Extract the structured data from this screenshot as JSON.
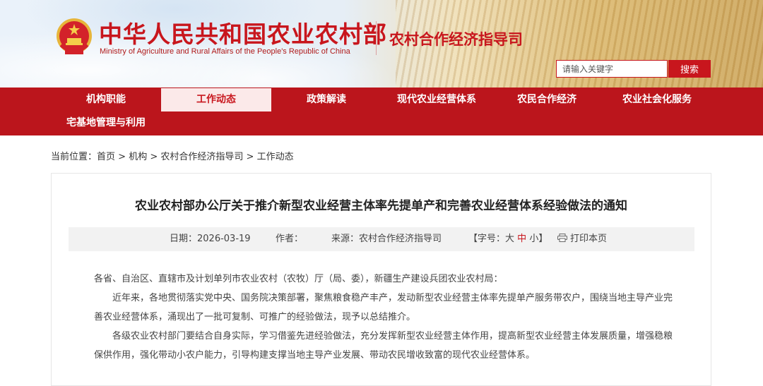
{
  "header": {
    "site_title": "中华人民共和国农业农村部",
    "site_subtitle": "Ministry of Agriculture and Rural Affairs of the People's Republic of China",
    "section_title": "农村合作经济指导司",
    "emblem_icon": "national-emblem-icon",
    "brand_color": "#c8161d"
  },
  "search": {
    "placeholder": "请输入关键字",
    "button_label": "搜索"
  },
  "nav": {
    "items": [
      {
        "label": "机构职能"
      },
      {
        "label": "工作动态"
      },
      {
        "label": "政策解读"
      },
      {
        "label": "现代农业经营体系"
      },
      {
        "label": "农民合作经济"
      },
      {
        "label": "农业社会化服务"
      },
      {
        "label": "宅基地管理与利用"
      }
    ],
    "active": "工作动态"
  },
  "breadcrumb": {
    "prefix": "当前位置：",
    "items": [
      "首页",
      "机构",
      "农村合作经济指导司",
      "工作动态"
    ],
    "separator": " > "
  },
  "article": {
    "title": "农业农村部办公厅关于推介新型农业经营主体率先提单产和完善农业经营体系经验做法的通知",
    "meta": {
      "date_label": "日期：",
      "date": "2026-03-19",
      "author_label": "作者：",
      "source_label": "来源：",
      "source": "农村合作经济指导司",
      "fontsize_open": "【字号：",
      "font_large": "大",
      "font_medium": "中",
      "font_small": "小",
      "fontsize_close": "】",
      "print_icon": "printer-icon",
      "print_label": "打印本页"
    },
    "paragraphs": [
      "各省、自治区、直辖市及计划单列市农业农村（农牧）厅（局、委），新疆生产建设兵团农业农村局：",
      "近年来，各地贯彻落实党中央、国务院决策部署，聚焦粮食稳产丰产，发动新型农业经营主体率先提单产服务带农户，围绕当地主导产业完善农业经营体系，涌现出了一批可复制、可推广的经验做法，现予以总结推介。",
      "各级农业农村部门要结合自身实际，学习借鉴先进经验做法，充分发挥新型农业经营主体作用，提高新型农业经营主体发展质量，增强稳粮保供作用，强化带动小农户能力，引导构建支撑当地主导产业发展、带动农民增收致富的现代农业经营体系。"
    ]
  }
}
